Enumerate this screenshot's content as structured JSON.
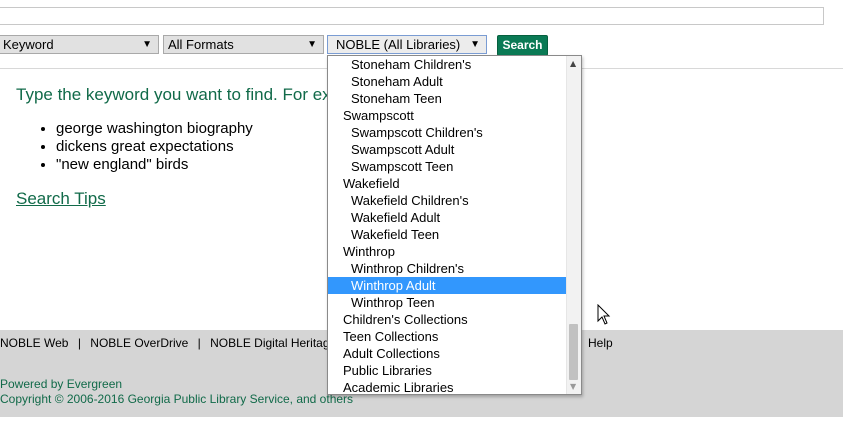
{
  "search_form": {
    "query_value": "",
    "search_type_selected": "Keyword",
    "format_selected": "All Formats",
    "library_selected": "NOBLE (All Libraries)",
    "search_button": "Search"
  },
  "main": {
    "instructions": "Type the keyword you want to find. For ex",
    "examples": [
      "george washington biography",
      "dickens great expectations",
      "\"new england\" birds"
    ],
    "search_tips": "Search Tips"
  },
  "footer": {
    "links": [
      "NOBLE Web",
      "NOBLE OverDrive",
      "NOBLE Digital Heritage"
    ],
    "separator": "|",
    "help": "Help",
    "powered": "Powered by Evergreen",
    "copyright": "Copyright © 2006-2016 Georgia Public Library Service, and others"
  },
  "library_dropdown": {
    "options": [
      {
        "label": "Stoneham Children's",
        "level": "child",
        "selected": false
      },
      {
        "label": "Stoneham Adult",
        "level": "child",
        "selected": false
      },
      {
        "label": "Stoneham Teen",
        "level": "child",
        "selected": false
      },
      {
        "label": "Swampscott",
        "level": "group",
        "selected": false
      },
      {
        "label": "Swampscott Children's",
        "level": "child",
        "selected": false
      },
      {
        "label": "Swampscott Adult",
        "level": "child",
        "selected": false
      },
      {
        "label": "Swampscott Teen",
        "level": "child",
        "selected": false
      },
      {
        "label": "Wakefield",
        "level": "group",
        "selected": false
      },
      {
        "label": "Wakefield Children's",
        "level": "child",
        "selected": false
      },
      {
        "label": "Wakefield Adult",
        "level": "child",
        "selected": false
      },
      {
        "label": "Wakefield Teen",
        "level": "child",
        "selected": false
      },
      {
        "label": "Winthrop",
        "level": "group",
        "selected": false
      },
      {
        "label": "Winthrop Children's",
        "level": "child",
        "selected": false
      },
      {
        "label": "Winthrop Adult",
        "level": "child",
        "selected": true
      },
      {
        "label": "Winthrop Teen",
        "level": "child",
        "selected": false
      },
      {
        "label": "Children's Collections",
        "level": "group",
        "selected": false
      },
      {
        "label": "Teen Collections",
        "level": "group",
        "selected": false
      },
      {
        "label": "Adult Collections",
        "level": "group",
        "selected": false
      },
      {
        "label": "Public Libraries",
        "level": "group",
        "selected": false
      },
      {
        "label": "Academic Libraries",
        "level": "group",
        "selected": false
      }
    ],
    "highlight_color": "#3297fd"
  },
  "colors": {
    "brand_green": "#116a49",
    "button_green": "#0a7a55",
    "footer_bg": "#d5d5d5"
  }
}
